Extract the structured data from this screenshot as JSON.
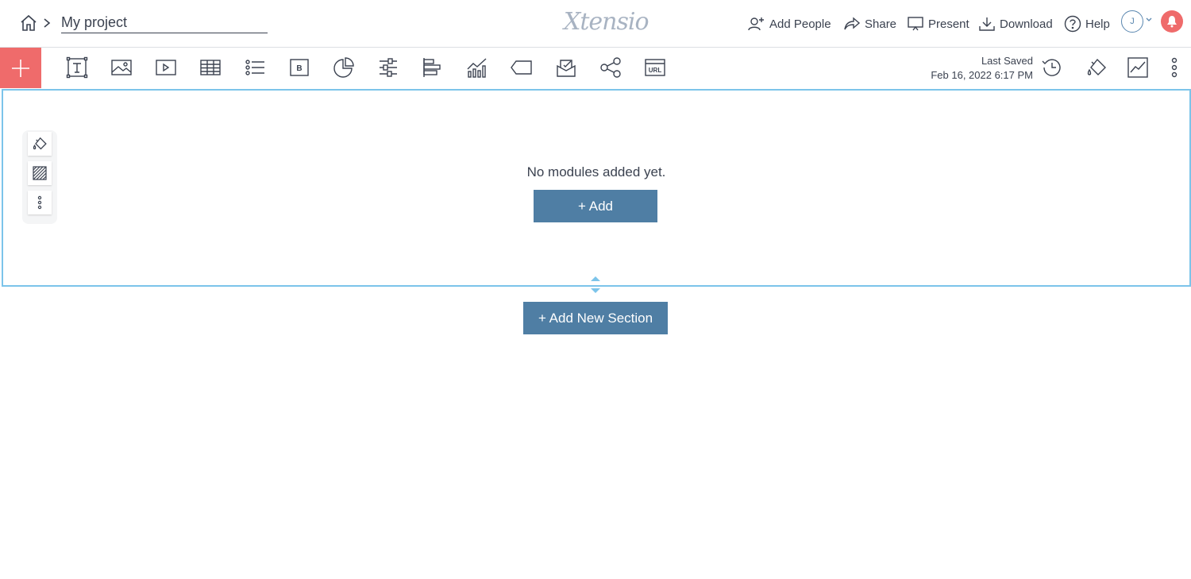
{
  "header": {
    "project_name": "My project",
    "logo_text": "Xtensio",
    "actions": {
      "add_people": "Add People",
      "share": "Share",
      "present": "Present",
      "download": "Download",
      "help": "Help"
    },
    "avatar_initial": "J"
  },
  "toolbar": {
    "modules": [
      {
        "icon": "text-module-icon"
      },
      {
        "icon": "image-module-icon"
      },
      {
        "icon": "video-module-icon"
      },
      {
        "icon": "table-module-icon"
      },
      {
        "icon": "list-module-icon"
      },
      {
        "icon": "button-module-icon"
      },
      {
        "icon": "pie-chart-module-icon"
      },
      {
        "icon": "slider-module-icon"
      },
      {
        "icon": "bar-chart-module-icon"
      },
      {
        "icon": "line-chart-module-icon"
      },
      {
        "icon": "tag-module-icon"
      },
      {
        "icon": "embed-module-icon"
      },
      {
        "icon": "share-network-module-icon"
      },
      {
        "icon": "url-module-icon"
      }
    ],
    "last_saved_label": "Last Saved",
    "last_saved_time": "Feb 16, 2022 6:17 PM"
  },
  "section": {
    "empty_text": "No modules added yet.",
    "add_label": "+ Add"
  },
  "add_section_label": "+ Add New Section",
  "colors": {
    "accent": "#ef6b6b",
    "primary_button": "#4f7ea4",
    "section_border": "#7cc4ea"
  }
}
